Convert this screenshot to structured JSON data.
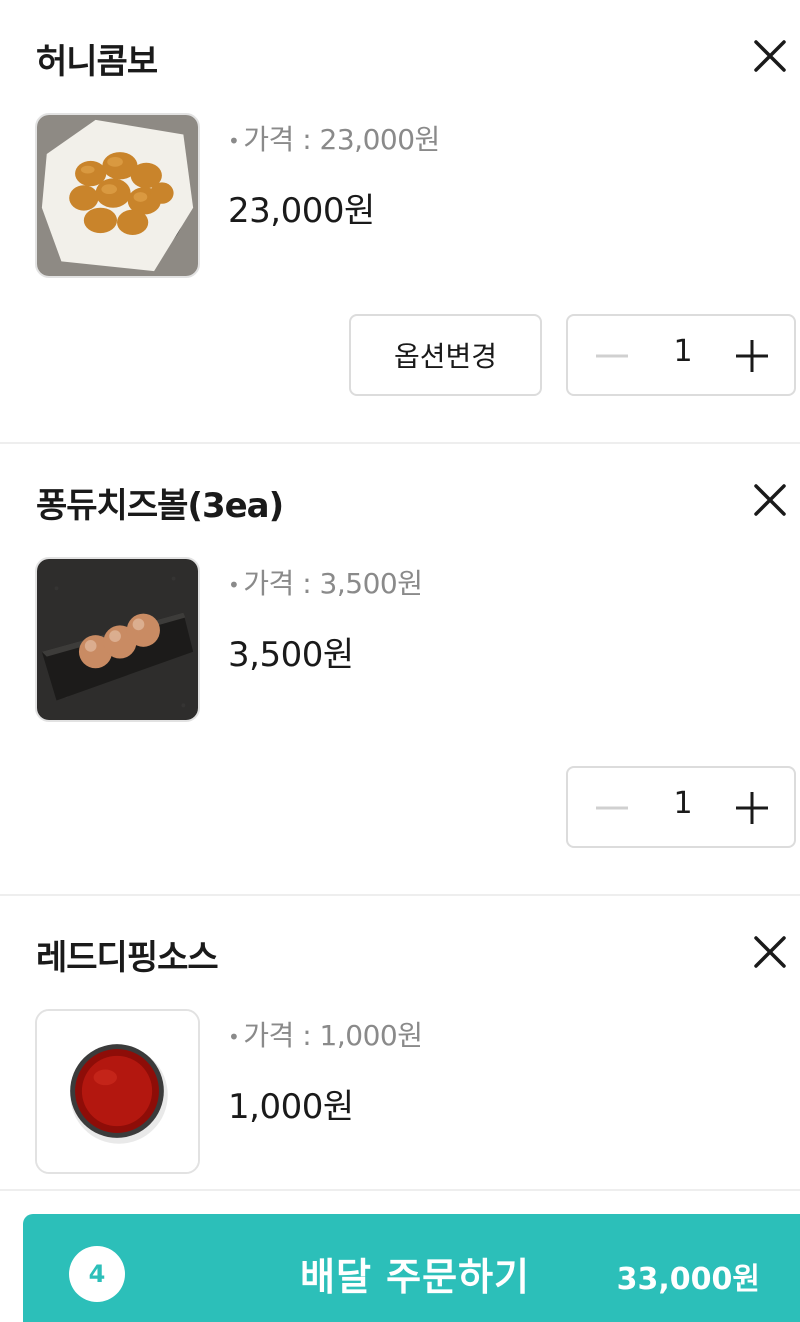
{
  "items": [
    {
      "name": "허니콤보",
      "price_label": "가격 : 23,000원",
      "total": "23,000원",
      "quantity": "1",
      "option_button": "옵션변경",
      "image": "fried-chicken-basket"
    },
    {
      "name": "퐁듀치즈볼(3ea)",
      "price_label": "가격 : 3,500원",
      "total": "3,500원",
      "quantity": "1",
      "image": "cheese-balls-plate"
    },
    {
      "name": "레드디핑소스",
      "price_label": "가격 : 1,000원",
      "total": "1,000원",
      "image": "red-dipping-sauce-cup"
    }
  ],
  "order_bar": {
    "count": "4",
    "label": "배달 주문하기",
    "total": "33,000원"
  },
  "icons": {
    "close": "close-icon",
    "minus": "minus-icon",
    "plus": "plus-icon",
    "bullet": "•"
  },
  "colors": {
    "accent": "#2cbfb9",
    "muted_text": "#8a8a8a",
    "border": "#dcdcdc"
  }
}
